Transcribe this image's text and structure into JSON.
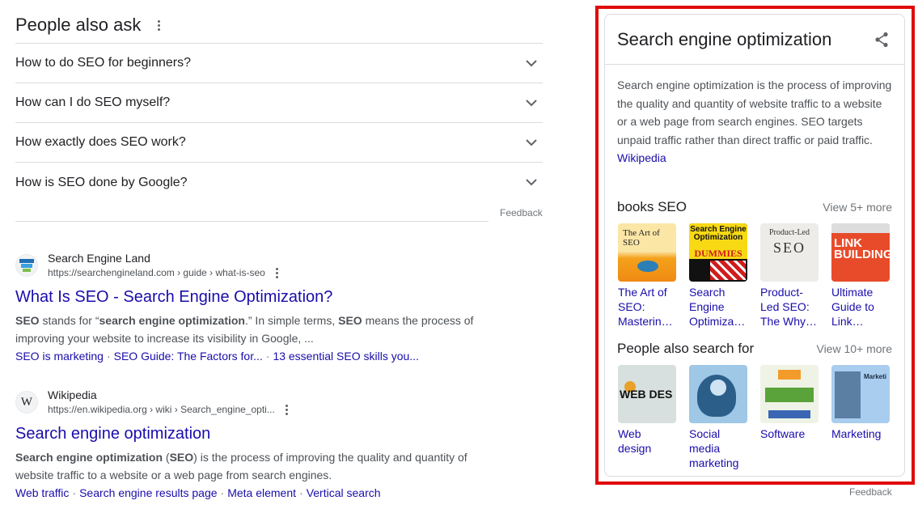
{
  "people_also_ask": {
    "title": "People also ask",
    "questions": [
      "How to do SEO for beginners?",
      "How can I do SEO myself?",
      "How exactly does SEO work?",
      "How is SEO done by Google?"
    ],
    "feedback": "Feedback"
  },
  "results": [
    {
      "site_name": "Search Engine Land",
      "url": "https://searchengineland.com › guide › what-is-seo",
      "favicon_label": "Search Engine Land",
      "title": "What Is SEO - Search Engine Optimization?",
      "snippet_line1": [
        "SEO",
        " stands for “",
        "search engine optimization",
        ".” In simple terms, ",
        "SEO",
        " means the process of"
      ],
      "snippet_line2": "improving your website to increase its visibility in Google, ...",
      "sitelinks": [
        "SEO is marketing",
        "SEO Guide: The Factors for...",
        "13 essential SEO skills you..."
      ]
    },
    {
      "site_name": "Wikipedia",
      "url": "https://en.wikipedia.org › wiki › Search_engine_opti...",
      "favicon_label": "W",
      "title": "Search engine optimization",
      "snippet_line1": [
        "Search engine optimization",
        " (",
        "SEO",
        ") is the process of improving the quality and quantity of"
      ],
      "snippet_line2": "website traffic to a website or a web page from search engines.",
      "sitelinks": [
        "Web traffic",
        "Search engine results page",
        "Meta element",
        "Vertical search"
      ]
    }
  ],
  "knowledge_panel": {
    "title": "Search engine optimization",
    "description": "Search engine optimization is the process of improving the quality and quantity of website traffic to a website or a web page from search engines. SEO targets unpaid traffic rather than direct traffic or paid traffic.",
    "source": "Wikipedia",
    "books": {
      "title": "books SEO",
      "view_more": "View 5+ more",
      "items": [
        {
          "label": "The Art of SEO: Masterin…",
          "thumb_text": "The Art of SEO"
        },
        {
          "label": "Search Engine Optimiza…",
          "thumb_text_top": "Search Engine Optimization",
          "thumb_text_mid": "DUMMIES"
        },
        {
          "label": "Product-Led SEO: The Why…",
          "thumb_text": "Product-Led",
          "thumb_text_big": "SEO"
        },
        {
          "label": "Ultimate Guide to Link…",
          "thumb_text": "LINK BUILDING"
        }
      ]
    },
    "related": {
      "title": "People also search for",
      "view_more": "View 10+ more",
      "items": [
        {
          "label": "Web design",
          "thumb_text": "WEB DES"
        },
        {
          "label": "Social media marketing",
          "thumb_text": ""
        },
        {
          "label": "Software",
          "thumb_text": ""
        },
        {
          "label": "Marketing",
          "thumb_text": "Marketi"
        }
      ]
    },
    "feedback": "Feedback"
  },
  "colors": {
    "link": "#1a0dab",
    "text": "#202124",
    "muted": "#70757a",
    "highlight_border": "#e00b0b"
  },
  "icons": [
    "more-vert-icon",
    "chevron-down-icon",
    "share-icon"
  ]
}
